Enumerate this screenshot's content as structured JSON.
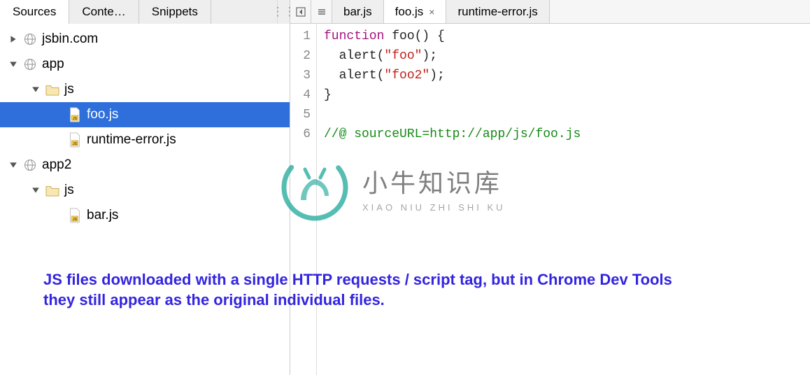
{
  "sidebar": {
    "tabs": [
      {
        "label": "Sources",
        "active": true
      },
      {
        "label": "Conte…",
        "active": false
      },
      {
        "label": "Snippets",
        "active": false
      }
    ],
    "tree": [
      {
        "kind": "domain",
        "label": "jsbin.com",
        "expanded": false,
        "depth": 0
      },
      {
        "kind": "domain",
        "label": "app",
        "expanded": true,
        "depth": 0
      },
      {
        "kind": "folder",
        "label": "js",
        "expanded": true,
        "depth": 1
      },
      {
        "kind": "file",
        "label": "foo.js",
        "depth": 2,
        "selected": true
      },
      {
        "kind": "file",
        "label": "runtime-error.js",
        "depth": 2
      },
      {
        "kind": "domain",
        "label": "app2",
        "expanded": true,
        "depth": 0
      },
      {
        "kind": "folder",
        "label": "js",
        "expanded": true,
        "depth": 1
      },
      {
        "kind": "file",
        "label": "bar.js",
        "depth": 2
      }
    ]
  },
  "editor": {
    "tabs": [
      {
        "label": "bar.js",
        "active": false,
        "closable": false
      },
      {
        "label": "foo.js",
        "active": true,
        "closable": true
      },
      {
        "label": "runtime-error.js",
        "active": false,
        "closable": false
      }
    ],
    "code": {
      "lines": [
        [
          {
            "t": "function ",
            "c": "kw"
          },
          {
            "t": "foo",
            "c": "fn"
          },
          {
            "t": "() {",
            "c": ""
          }
        ],
        [
          {
            "t": "  alert(",
            "c": ""
          },
          {
            "t": "\"foo\"",
            "c": "str"
          },
          {
            "t": ");",
            "c": ""
          }
        ],
        [
          {
            "t": "  alert(",
            "c": ""
          },
          {
            "t": "\"foo2\"",
            "c": "str"
          },
          {
            "t": ");",
            "c": ""
          }
        ],
        [
          {
            "t": "}",
            "c": ""
          }
        ],
        [],
        [
          {
            "t": "//@ sourceURL=http://app/js/foo.js",
            "c": "cmt"
          }
        ]
      ]
    }
  },
  "caption": "JS files downloaded with a single HTTP requests / script tag, but in Chrome Dev Tools they still appear as the original individual files.",
  "watermark": {
    "cn": "小牛知识库",
    "py": "XIAO NIU ZHI SHI KU"
  }
}
